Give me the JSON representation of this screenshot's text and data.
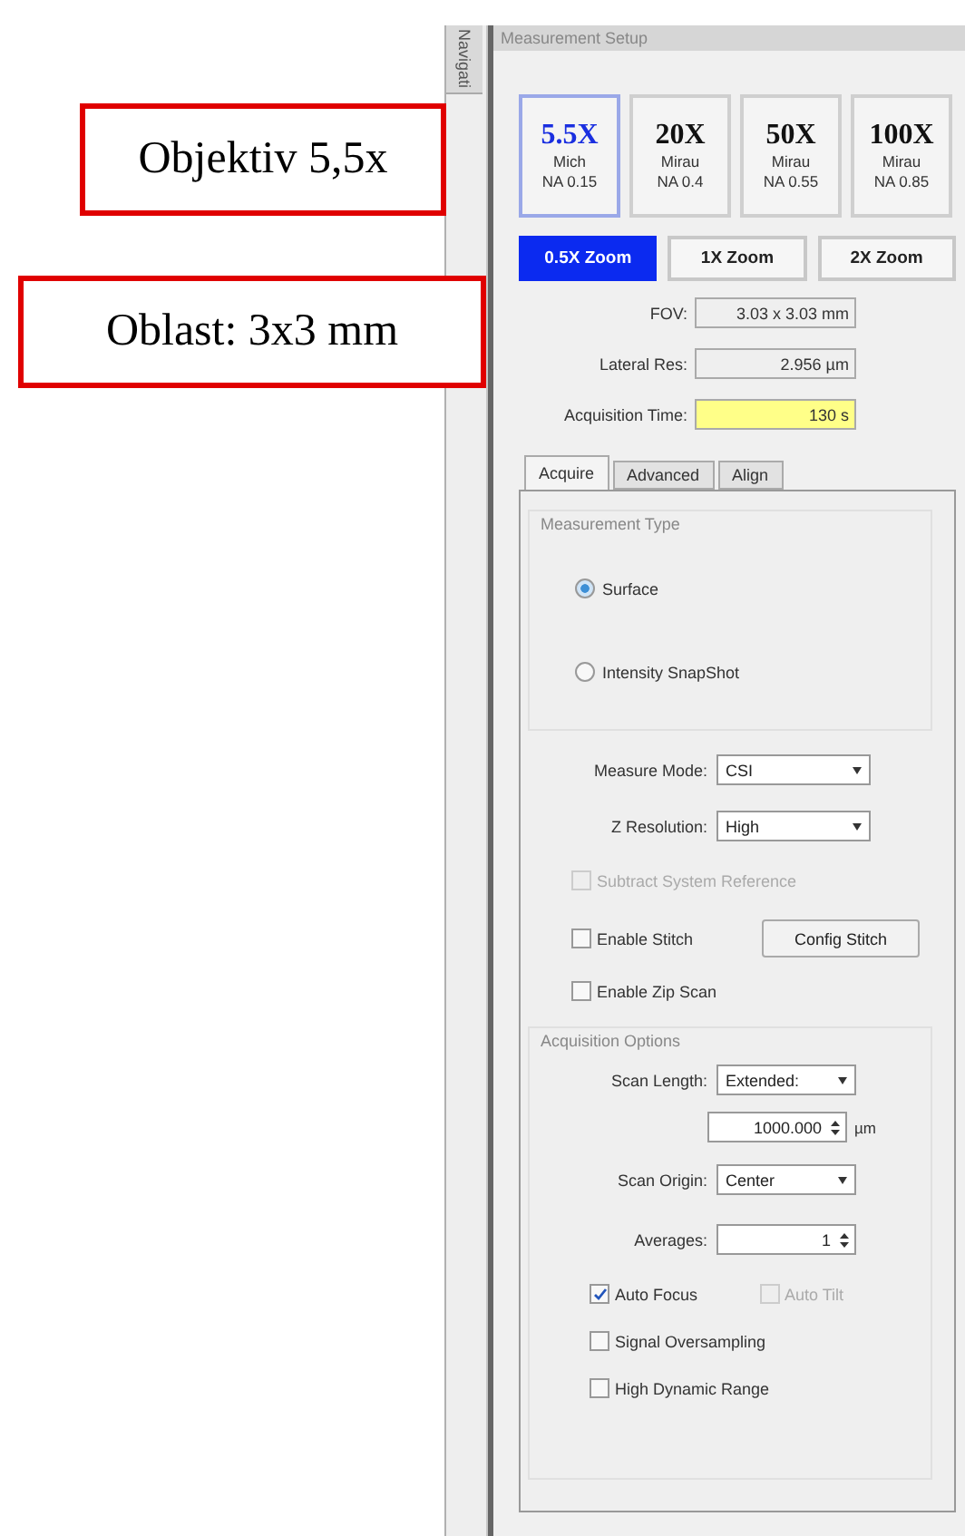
{
  "annotations": [
    {
      "text": "Objektiv 5,5x"
    },
    {
      "text": "Oblast: 3x3 mm"
    }
  ],
  "side_tab": {
    "label": "Navigati"
  },
  "panel": {
    "title": "Measurement Setup"
  },
  "objectives": [
    {
      "magnification": "5.5X",
      "type": "Mich",
      "na": "NA 0.15",
      "selected": true
    },
    {
      "magnification": "20X",
      "type": "Mirau",
      "na": "NA 0.4",
      "selected": false
    },
    {
      "magnification": "50X",
      "type": "Mirau",
      "na": "NA 0.55",
      "selected": false
    },
    {
      "magnification": "100X",
      "type": "Mirau",
      "na": "NA 0.85",
      "selected": false
    }
  ],
  "zoom_buttons": [
    {
      "label": "0.5X Zoom",
      "selected": true
    },
    {
      "label": "1X Zoom",
      "selected": false
    },
    {
      "label": "2X Zoom",
      "selected": false
    }
  ],
  "info_fields": [
    {
      "label": "FOV:",
      "value": "3.03 x 3.03 mm",
      "highlighted": false
    },
    {
      "label": "Lateral Res:",
      "value": "2.956 µm",
      "highlighted": false
    },
    {
      "label": "Acquisition Time:",
      "value": "130 s",
      "highlighted": true
    }
  ],
  "tabs": [
    {
      "label": "Acquire",
      "selected": true
    },
    {
      "label": "Advanced",
      "selected": false
    },
    {
      "label": "Align",
      "selected": false
    }
  ],
  "measurement_type": {
    "title": "Measurement Type",
    "options": [
      {
        "label": "Surface",
        "selected": true
      },
      {
        "label": "Intensity SnapShot",
        "selected": false
      }
    ]
  },
  "measure_mode": {
    "label": "Measure Mode:",
    "value": "CSI"
  },
  "z_resolution": {
    "label": "Z Resolution:",
    "value": "High"
  },
  "subtract_reference": {
    "label": "Subtract System Reference",
    "checked": false,
    "disabled": true
  },
  "enable_stitch": {
    "label": "Enable Stitch",
    "checked": false,
    "disabled": false
  },
  "config_stitch_button": "Config Stitch",
  "enable_zip_scan": {
    "label": "Enable Zip Scan",
    "checked": false,
    "disabled": false
  },
  "acquisition_options": {
    "title": "Acquisition Options",
    "scan_length": {
      "label": "Scan Length:",
      "value": "Extended:"
    },
    "scan_length_value": {
      "value": "1000.000",
      "unit": "µm"
    },
    "scan_origin": {
      "label": "Scan Origin:",
      "value": "Center"
    },
    "averages": {
      "label": "Averages:",
      "value": "1"
    },
    "auto_focus": {
      "label": "Auto Focus",
      "checked": true,
      "disabled": false
    },
    "auto_tilt": {
      "label": "Auto Tilt",
      "checked": false,
      "disabled": true
    },
    "signal_oversampling": {
      "label": "Signal Oversampling",
      "checked": false,
      "disabled": false
    },
    "high_dynamic_range": {
      "label": "High Dynamic Range",
      "checked": false,
      "disabled": false
    }
  }
}
